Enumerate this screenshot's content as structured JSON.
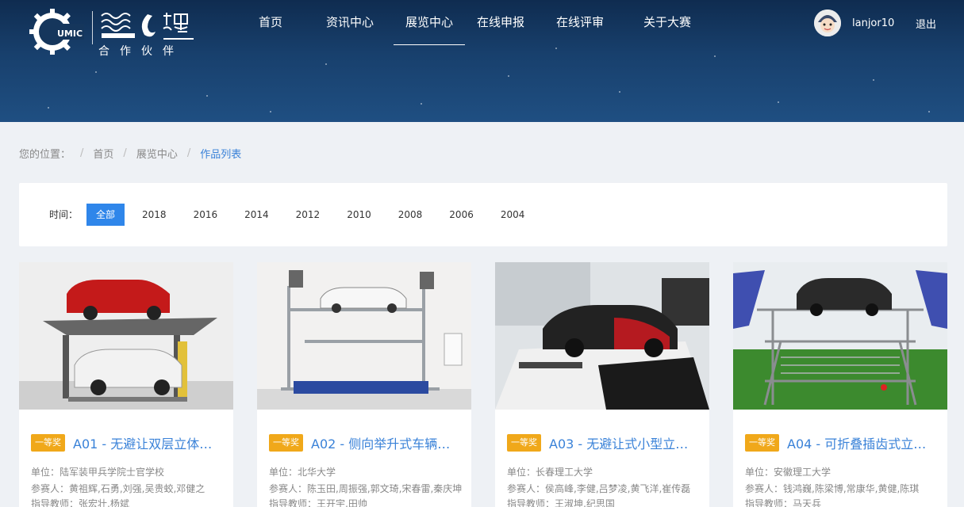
{
  "header": {
    "partner_text": "合作伙伴",
    "logo_badge": "UMIC",
    "nav": [
      "首页",
      "资讯中心",
      "展览中心",
      "在线申报",
      "在线评审",
      "关于大赛"
    ],
    "user": {
      "name": "lanjor10",
      "logout": "退出"
    }
  },
  "breadcrumb": {
    "label": "您的位置：",
    "items": [
      "首页",
      "展览中心",
      "作品列表"
    ]
  },
  "filter": {
    "label": "时间：",
    "options": [
      "全部",
      "2018",
      "2016",
      "2014",
      "2012",
      "2010",
      "2008",
      "2006",
      "2004"
    ],
    "selected": "全部"
  },
  "cards": [
    {
      "award": "一等奖",
      "title": "A01 - 无避让双层立体…",
      "unit": "单位：陆军装甲兵学院士官学校",
      "members": "参赛人：黄祖辉,石勇,刘强,吴贵蛟,邓健之",
      "advisor": "指导教师：张宏壮,杨斌"
    },
    {
      "award": "一等奖",
      "title": "A02 - 侧向举升式车辆…",
      "unit": "单位：北华大学",
      "members": "参赛人：陈玉田,周振强,郭文琦,宋春雷,秦庆坤",
      "advisor": "指导教师：王开宇,田帅"
    },
    {
      "award": "一等奖",
      "title": "A03 - 无避让式小型立…",
      "unit": "单位：长春理工大学",
      "members": "参赛人：侯高峰,李健,吕梦凌,黄飞洋,崔传磊",
      "advisor": "指导教师：王淑坤,纪思国"
    },
    {
      "award": "一等奖",
      "title": "A04 - 可折叠插齿式立…",
      "unit": "单位：安徽理工大学",
      "members": "参赛人：钱鸿巍,陈梁博,常康华,黄健,陈琪",
      "advisor": "指导教师：马天兵"
    }
  ]
}
